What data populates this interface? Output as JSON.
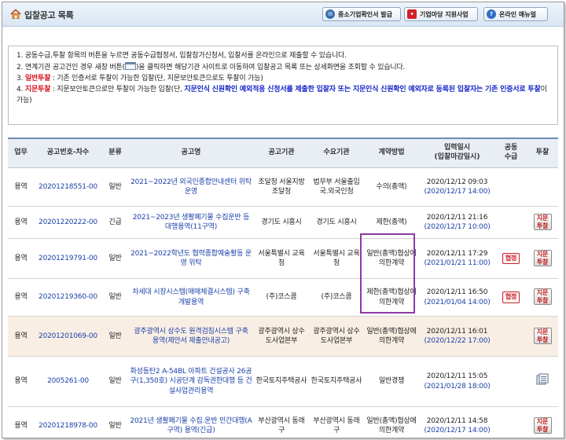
{
  "header": {
    "title": "입찰공고 목록",
    "buttons": [
      {
        "label": "중소기업확인서 발급",
        "icon": "certificate-icon",
        "color": "#3a6fb0"
      },
      {
        "label": "기업마당 지원사업",
        "icon": "business-support-icon",
        "color": "#d0202a"
      },
      {
        "label": "온라인 매뉴얼",
        "icon": "help-icon",
        "color": "#2f6fc4"
      }
    ]
  },
  "notice": {
    "line1": "1. 공동수급,투찰 항목의 버튼을 누르면 공동수급협정서, 입찰참가신청서, 입찰서를 온라인으로 제출할 수 있습니다.",
    "line2_a": "2. 연계기관 공고건인 경우 새창 버튼(",
    "line2_b": ")을 클릭하면 해당기관 사이트로 이동하여 입찰공고 목록 또는 상세화면을 조회할 수 있습니다.",
    "line3_num": "3.",
    "line3_red": "일반투찰",
    "line3_rest": " : 기존 인증서로 투찰이 가능한 입찰(단, 지문보안토큰으로도 투찰이 가능)",
    "line4_num": "4.",
    "line4_red": "지문투찰",
    "line4_rest": " : 지문보안토큰으로만 투찰이 가능한 입찰(단, ",
    "line4_blue": "지문인식 신원확인 예외적용 신청서를 제출한 입찰자 또는 지문인식 신원확인 예외자로 등록된 입찰자는 기존 인증서로 투찰",
    "line4_end": "이 가능)"
  },
  "table": {
    "headers": [
      "업무",
      "공고번호-차수",
      "분류",
      "공고명",
      "공고기관",
      "수요기관",
      "계약방법",
      "입력일시",
      "(입찰마감일시)",
      "공동",
      "수급",
      "투찰"
    ],
    "rows": [
      {
        "biz": "용역",
        "no": "20201218551-00",
        "type": "일반",
        "name": "2021~2022년 외국인종합안내센터 위탁운영",
        "org": "조달청 서울지방조달청",
        "demand": "법무부 서울출입국.외국인청",
        "method": "수의(총액)",
        "date1": "2020/12/12 09:03",
        "date2": "(2020/12/17 14:00)",
        "joint": "",
        "bid": "",
        "bidicon": ""
      },
      {
        "biz": "용역",
        "no": "20201220222-00",
        "type": "긴급",
        "name": "2021~2023년 생활폐기물 수집운반 등 대행용역(11구역)",
        "org": "경기도 시흥시",
        "demand": "경기도 시흥시",
        "method": "제한(총액)",
        "date1": "2020/12/11 21:16",
        "date2": "(2020/12/17 10:00)",
        "joint": "",
        "bid": "지문\n투찰",
        "bidicon": ""
      },
      {
        "biz": "용역",
        "no": "20201219791-00",
        "type": "일반",
        "name": "2021~2022학년도 협력종합예술활동 운영 위탁",
        "org": "서울특별시 교육청",
        "demand": "서울특별시 교육청",
        "method": "일반(총액)협상에의한계약",
        "date1": "2020/12/11 17:29",
        "date2": "(2021/01/21 11:00)",
        "joint": "협정",
        "bid": "지문\n투찰",
        "bidicon": ""
      },
      {
        "biz": "용역",
        "no": "20201219360-00",
        "type": "일반",
        "name": "차세대 시장시스템(매매체결시스템) 구축 개발용역",
        "org": "(주)코스콤",
        "demand": "(주)코스콤",
        "method": "제한(총액)협상에의한계약",
        "date1": "2020/12/11 16:50",
        "date2": "(2021/01/04 14:00)",
        "joint": "협정",
        "bid": "지문\n투찰",
        "bidicon": ""
      },
      {
        "biz": "용역",
        "no": "20201201069-00",
        "type": "일반",
        "name": "광주광역시 상수도 원격검침시스템 구축 용역(제안서 제출안내공고)",
        "org": "광주광역시 상수도사업본부",
        "demand": "광주광역시 상수도사업본부",
        "method": "일반(총액)협상에의한계약",
        "date1": "2020/12/11 16:01",
        "date2": "(2020/12/22 17:00)",
        "joint": "",
        "bid": "지문\n투찰",
        "bidicon": ""
      },
      {
        "biz": "용역",
        "no": "2005261-00",
        "type": "일반",
        "name": "화성동탄2 A-54BL 아파트 건설공사 26공구(1,350호) 시공단계 감독권한대행 등 건설사업관리용역",
        "org": "한국토지주택공사",
        "demand": "한국토지주택공사",
        "method": "일반경쟁",
        "date1": "2020/12/11 15:05",
        "date2": "(2021/01/28 18:00)",
        "joint": "",
        "bid": "",
        "bidicon": "new-window-icon"
      },
      {
        "biz": "용역",
        "no": "20201218978-00",
        "type": "일반",
        "name": "2021년 생활폐기물 수집.운반 민간대행(A구역) 용역(긴급)",
        "org": "부산광역시 동래구",
        "demand": "부산광역시 동래구",
        "method": "일반(총액)협상에의한계약",
        "date1": "2020/12/11 14:58",
        "date2": "(2020/12/17 14:00)",
        "joint": "",
        "bid": "지문\n투찰",
        "bidicon": ""
      }
    ]
  }
}
